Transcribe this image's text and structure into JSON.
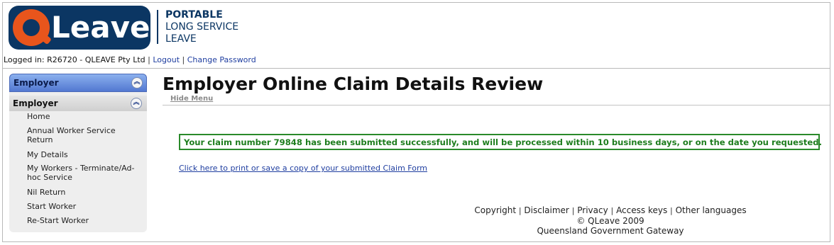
{
  "header": {
    "logo_text": "Leave",
    "tagline": [
      "PORTABLE",
      "LONG SERVICE",
      "LEAVE"
    ],
    "login_status": "Logged in: R26720 - QLEAVE Pty Ltd",
    "logout_label": "Logout",
    "change_password_label": "Change Password"
  },
  "sidebar": {
    "section_title": "Employer",
    "group_title": "Employer",
    "items": [
      {
        "label": "Home"
      },
      {
        "label": "Annual Worker Service Return"
      },
      {
        "label": "My Details"
      },
      {
        "label": "My Workers - Terminate/Ad-hoc Service"
      },
      {
        "label": "Nil Return"
      },
      {
        "label": "Start Worker"
      },
      {
        "label": "Re-Start Worker"
      }
    ]
  },
  "main": {
    "title": "Employer Online Claim Details Review",
    "hide_menu_label": "Hide Menu",
    "success_message": "Your claim number 79848 has been submitted successfully, and will be processed within 10 business days, or on the date you requested.",
    "print_link": "Click here to print or save a copy of your submitted Claim Form"
  },
  "footer": {
    "links": [
      "Copyright",
      "Disclaimer",
      "Privacy",
      "Access keys",
      "Other languages"
    ],
    "copyright": "© QLeave 2009",
    "gateway": "Queensland Government Gateway"
  },
  "colors": {
    "brand_navy": "#0b3663",
    "brand_orange": "#e8551c",
    "success_green": "#1e7d1e",
    "link_blue": "#1f3ea0"
  }
}
